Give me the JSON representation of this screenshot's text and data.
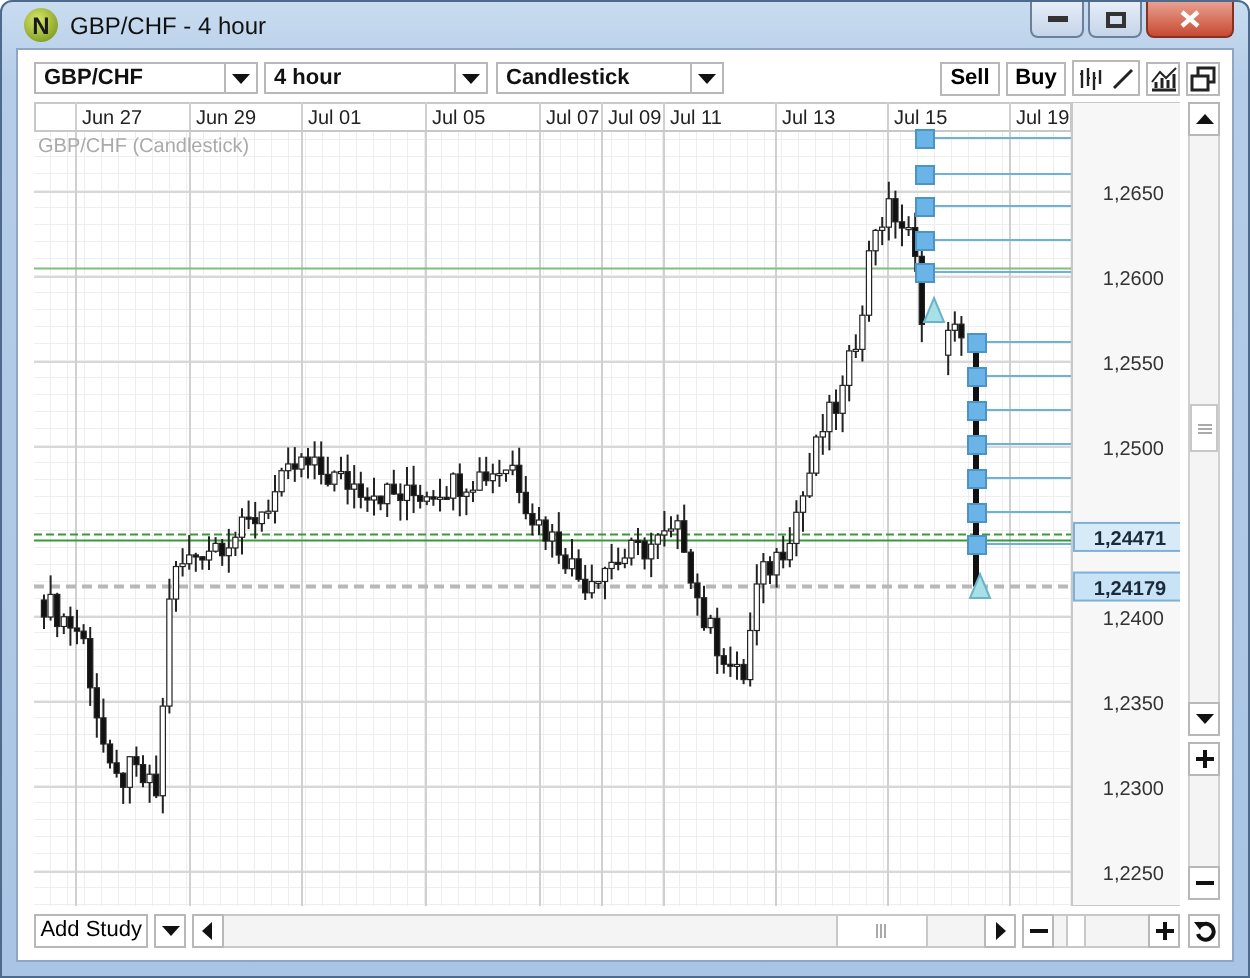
{
  "window": {
    "title": "GBP/CHF - 4 hour",
    "icon_letter": "N"
  },
  "toolbar": {
    "dropdowns": [
      {
        "value": "GBP/CHF"
      },
      {
        "value": "4 hour"
      },
      {
        "value": "Candlestick"
      }
    ],
    "buttons": [
      "Sell",
      "Buy"
    ]
  },
  "chart": {
    "legend": "GBP/CHF (Candlestick)",
    "date_labels": [
      "Jun 27",
      "Jun 29",
      "Jul 01",
      "Jul 05",
      "Jul 07",
      "Jul 09",
      "Jul 11",
      "Jul 13",
      "Jul 15",
      "Jul 19"
    ],
    "price_labels": [
      "1,2650",
      "1,2600",
      "1,2550",
      "1,2500",
      "1,2400",
      "1,2350",
      "1,2300",
      "1,2250"
    ],
    "price_markers": [
      {
        "label": "1,24471",
        "kind": "bid"
      },
      {
        "label": "1,24179",
        "kind": "ask"
      }
    ]
  },
  "bottom_bar": {
    "add_study": "Add Study"
  }
}
